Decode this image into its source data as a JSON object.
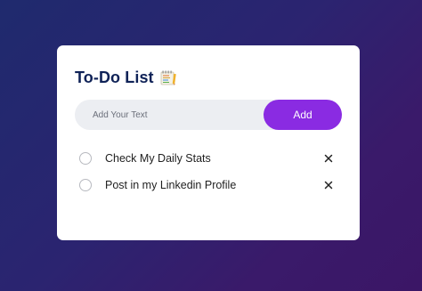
{
  "card": {
    "title": "To-Do List",
    "title_icon": "notepad-icon"
  },
  "input": {
    "placeholder": "Add Your Text",
    "value": ""
  },
  "add_button": {
    "label": "Add"
  },
  "todos": [
    {
      "text": "Check My Daily Stats",
      "checked": false,
      "delete_icon": "close-icon"
    },
    {
      "text": "Post in my Linkedin Profile",
      "checked": false,
      "delete_icon": "close-icon"
    }
  ],
  "colors": {
    "title": "#0f2257",
    "accent": "#8a2be2",
    "input_bg": "#eceef2"
  }
}
